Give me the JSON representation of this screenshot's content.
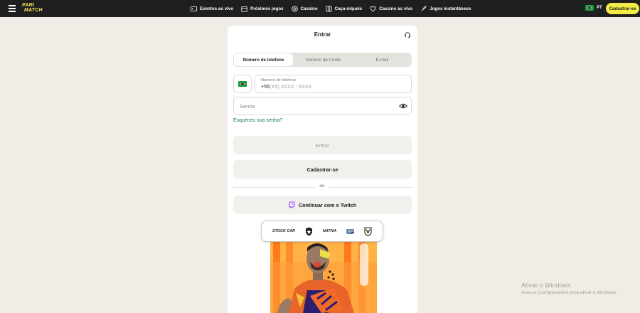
{
  "topbar": {
    "logo_line1": "PARI",
    "logo_line2": "MATCH",
    "nav": [
      {
        "label": "Eventos ao vivo",
        "icon": "live-events-icon"
      },
      {
        "label": "Próximos jogos",
        "icon": "calendar-icon"
      },
      {
        "label": "Cassino",
        "icon": "casino-chip-icon"
      },
      {
        "label": "Caça-níqueis",
        "icon": "slot-machine-icon"
      },
      {
        "label": "Cassino ao vivo",
        "icon": "live-casino-icon"
      },
      {
        "label": "Jogos instantâneos",
        "icon": "rocket-icon"
      }
    ],
    "language": "PT",
    "signup_label": "Cadastrar-se"
  },
  "login": {
    "title": "Entrar",
    "tabs": [
      {
        "label": "Número de telefone",
        "active": true
      },
      {
        "label": "Número da Conta",
        "active": false
      },
      {
        "label": "E-mail",
        "active": false
      }
    ],
    "phone": {
      "label": "Número de telefone",
      "prefix": "+55",
      "placeholder": "(XX) XXXX - XXXX"
    },
    "password_placeholder": "Senha",
    "forgot_label": "Esqueceu sua senha?",
    "submit_label": "Entrar",
    "register_label": "Cadastrar-se",
    "or_label": "ou",
    "twitch_label": "Continuar com o Twitch"
  },
  "promo": {
    "sponsors": [
      "STOCK CAR",
      "NATIVA",
      "NATIVA"
    ]
  },
  "watermark": {
    "title": "Ativar o Windows",
    "subtitle": "Acesse Configurações para ativar o Windows."
  },
  "colors": {
    "topbar": "#1f1f1f",
    "accent_yellow": "#f3ec47",
    "link_green": "#1b7a5a",
    "twitch_purple": "#9146ff",
    "background": "#efede6"
  }
}
